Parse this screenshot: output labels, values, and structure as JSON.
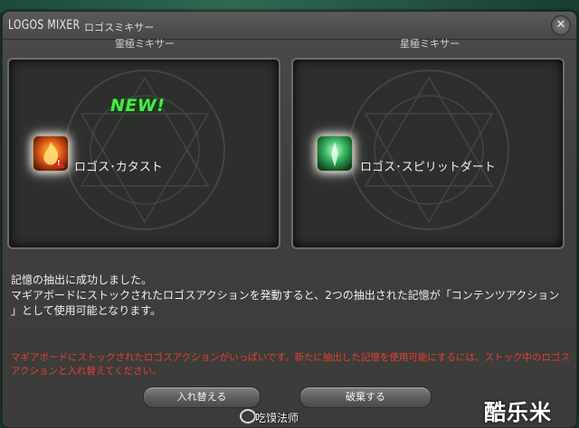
{
  "window": {
    "title_en": "LOGOS MIXER",
    "title_jp": "ロゴスミキサー",
    "close_glyph": "✕"
  },
  "left_mixer": {
    "label": "霊極ミキサー",
    "new_badge": "NEW!",
    "action_name": "ロゴス･カタスト",
    "action_icon": "logos-catastrophe-icon",
    "warning_icon": "warning-triangle-icon",
    "gem_colors": [
      "#e8d23a",
      "#c040e0",
      "#3a5ae8"
    ]
  },
  "right_mixer": {
    "label": "星極ミキサー",
    "action_name": "ロゴス･スピリットダート",
    "action_icon": "logos-spirit-dart-icon",
    "gem_colors": [
      "#4ed63a",
      "#3ad6d0",
      "#e83a3a"
    ]
  },
  "message": {
    "line1": "記憶の抽出に成功しました。",
    "line2": "マギアボードにストックされたロゴスアクションを発動すると、2つの抽出された記憶が「コンテンツアクション",
    "line3": "」として使用可能となります。"
  },
  "warning_message": "マギアボードにストックされたロゴスアクションがいっぱいです。新たに抽出した記憶を使用可能にするには、ストック中のロゴスアクションと入れ替えてください。",
  "buttons": {
    "replace": "入れ替える",
    "discard": "破棄する"
  },
  "watermarks": {
    "weibo_name": "吃馍法师",
    "site": "酷乐米"
  }
}
